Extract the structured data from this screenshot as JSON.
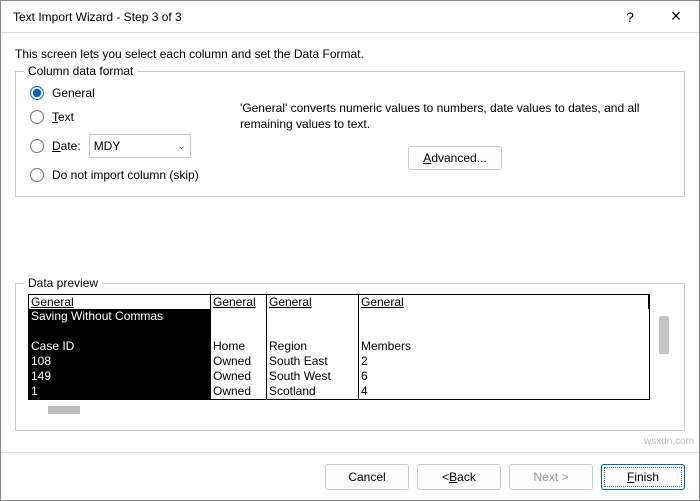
{
  "titlebar": {
    "title": "Text Import Wizard - Step 3 of 3",
    "help": "?",
    "close": "×"
  },
  "intro": "This screen lets you select each column and set the Data Format.",
  "format": {
    "legend": "Column data format",
    "general": "General",
    "text": "Text",
    "date": "Date:",
    "date_value": "MDY",
    "skip": "Do not import column (skip)"
  },
  "desc": {
    "text": "'General' converts numeric values to numbers, date values to dates, and all remaining values to text.",
    "advanced_u": "A",
    "advanced_rest": "dvanced..."
  },
  "preview": {
    "legend": "Data preview",
    "header": [
      "General",
      "General",
      "General",
      "General"
    ],
    "col1": "Saving Without Commas\n\nCase ID\n108\n149\n1",
    "col2": "\n\nHome\nOwned\nOwned\nOwned",
    "col3": "\n\nRegion\nSouth East\nSouth West\nScotland",
    "col4": "\n\nMembers\n2\n6\n4"
  },
  "buttons": {
    "cancel": "Cancel",
    "back_lt": "< ",
    "back_u": "B",
    "back_rest": "ack",
    "next": "Next >",
    "finish_u": "F",
    "finish_rest": "inish"
  },
  "watermark": "wsxdn.com"
}
